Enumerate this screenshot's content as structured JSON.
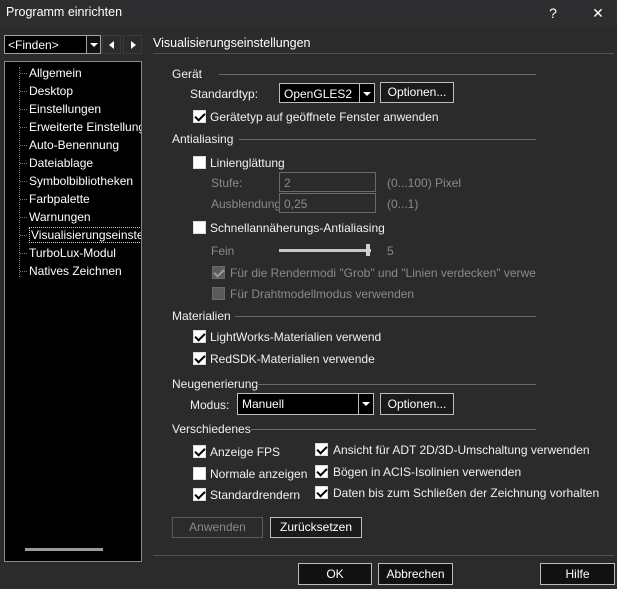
{
  "window": {
    "title": "Programm einrichten",
    "help_glyph": "?",
    "close_glyph": "✕"
  },
  "sidebar": {
    "search_value": "<Finden>",
    "items": [
      {
        "label": "Allgemein"
      },
      {
        "label": "Desktop"
      },
      {
        "label": "Einstellungen"
      },
      {
        "label": "Erweiterte Einstellung"
      },
      {
        "label": "Auto-Benennung"
      },
      {
        "label": "Dateiablage"
      },
      {
        "label": "Symbolbibliotheken"
      },
      {
        "label": "Farbpalette"
      },
      {
        "label": "Warnungen"
      },
      {
        "label": "Visualisierungseinste"
      },
      {
        "label": "TurboLux-Modul"
      },
      {
        "label": "Natives Zeichnen"
      }
    ]
  },
  "panel": {
    "title": "Visualisierungseinstellungen",
    "geraet": {
      "heading": "Gerät",
      "standardtyp_label": "Standardtyp:",
      "standardtyp_value": "OpenGLES2",
      "optionen_label": "Optionen...",
      "apply_open_windows_label": "Gerätetyp auf geöffnete Fenster anwenden",
      "apply_open_windows_checked": true
    },
    "antialiasing": {
      "heading": "Antialiasing",
      "linienglaettung_label": "Linienglättung",
      "linienglaettung_checked": false,
      "stufe_label": "Stufe:",
      "stufe_value": "2",
      "stufe_hint": "(0...100) Pixel",
      "ausblendung_label": "Ausblendung:",
      "ausblendung_value": "0,25",
      "ausblendung_hint": "(0...1)",
      "schnell_label": "Schnellannäherungs-Antialiasing",
      "schnell_checked": false,
      "fein_label": "Fein",
      "fein_value": "5",
      "fein_level": 1.0,
      "rendermodi_label": "Für die Rendermodi \"Grob\" und \"Linien verdecken\" verwe",
      "rendermodi_checked": true,
      "drahtmodell_label": "Für Drahtmodellmodus verwenden",
      "drahtmodell_checked": false
    },
    "materialien": {
      "heading": "Materialien",
      "lightworks_label": "LightWorks-Materialien verwend",
      "lightworks_checked": true,
      "redsdk_label": "RedSDK-Materialien verwende",
      "redsdk_checked": true
    },
    "neugenerierung": {
      "heading": "Neugenerierung",
      "modus_label": "Modus:",
      "modus_value": "Manuell",
      "optionen_label": "Optionen..."
    },
    "verschiedenes": {
      "heading": "Verschiedenes",
      "anzeige_fps_label": "Anzeige FPS",
      "anzeige_fps_checked": true,
      "normale_label": "Normale anzeigen",
      "normale_checked": false,
      "standardrendern_label": "Standardrendern",
      "standardrendern_checked": true,
      "adt_label": "Ansicht für ADT 2D/3D-Umschaltung verwenden",
      "adt_checked": true,
      "boegen_label": "Bögen in ACIS-Isolinien verwenden",
      "boegen_checked": true,
      "daten_label": "Daten bis zum Schließen der Zeichnung vorhalten",
      "daten_checked": true
    },
    "anwenden_label": "Anwenden",
    "zuruecksetzen_label": "Zurücksetzen"
  },
  "footer": {
    "ok_label": "OK",
    "abbrechen_label": "Abbrechen",
    "hilfe_label": "Hilfe"
  }
}
